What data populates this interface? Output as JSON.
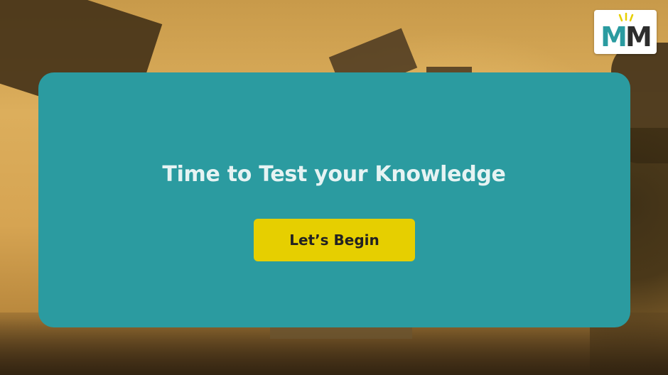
{
  "logo": {
    "text_part1": "M",
    "text_part2": "M",
    "accent_color": "#2a9ba0",
    "ray_color": "#e6cf00"
  },
  "card": {
    "title": "Time to Test your Knowledge",
    "button_label": "Let’s Begin",
    "background_color": "#2b9ba0",
    "button_color": "#e6cf00"
  }
}
